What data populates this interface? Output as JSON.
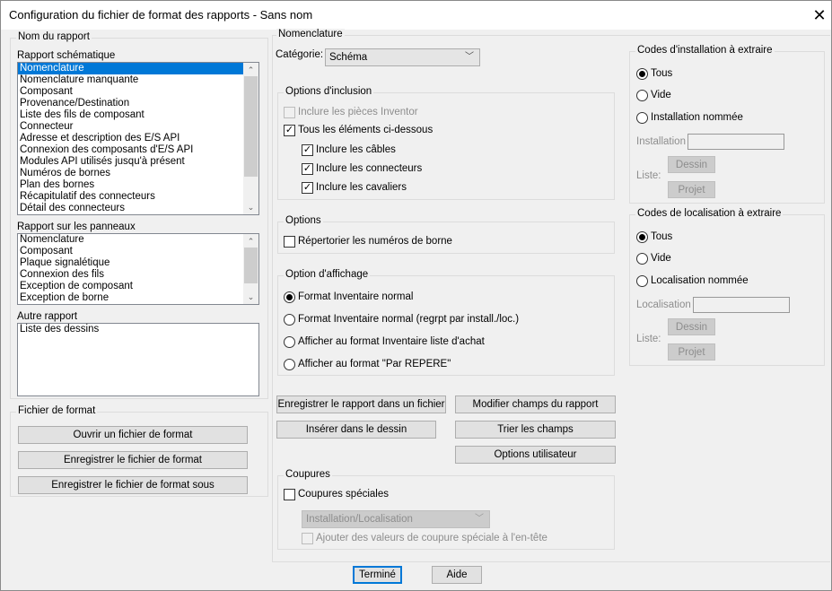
{
  "window": {
    "title": "Configuration du fichier de format des rapports - Sans nom",
    "close": "✕"
  },
  "left": {
    "group_title": "Nom du rapport",
    "schematic_label": "Rapport schématique",
    "schematic_items": [
      "Nomenclature",
      "Nomenclature manquante",
      "Composant",
      "Provenance/Destination",
      "Liste des fils de composant",
      "Connecteur",
      "Adresse et description des E/S API",
      "Connexion des composants d'E/S API",
      "Modules API utilisés jusqu'à présent",
      "Numéros de bornes",
      "Plan des bornes",
      "Récapitulatif des connecteurs",
      "Détail des connecteurs"
    ],
    "panel_label": "Rapport sur les panneaux",
    "panel_items": [
      "Nomenclature",
      "Composant",
      "Plaque signalétique",
      "Connexion des fils",
      "Exception de composant",
      "Exception de borne"
    ],
    "other_label": "Autre rapport",
    "other_items": [
      "Liste des dessins"
    ]
  },
  "format_file": {
    "title": "Fichier de format",
    "open": "Ouvrir un fichier de format",
    "save": "Enregistrer le fichier de format",
    "save_as": "Enregistrer le fichier de format sous"
  },
  "middle": {
    "group_title": "Nomenclature",
    "category_label": "Catégorie:",
    "category_value": "Schéma",
    "inclusion": {
      "title": "Options d'inclusion",
      "inventor": "Inclure les pièces Inventor",
      "all": "Tous les éléments ci-dessous",
      "cables": "Inclure les câbles",
      "connectors": "Inclure les connecteurs",
      "jumpers": "Inclure les cavaliers"
    },
    "options": {
      "title": "Options",
      "list_terminals": "Répertorier les numéros de borne"
    },
    "display": {
      "title": "Option d'affichage",
      "opts": [
        "Format Inventaire normal",
        "Format Inventaire normal (regrpt par install./loc.)",
        "Afficher au format Inventaire liste d'achat",
        "Afficher au format \"Par REPERE\""
      ]
    },
    "buttons": {
      "save_report": "Enregistrer le rapport dans un fichier",
      "modify_fields": "Modifier champs du rapport",
      "insert": "Insérer dans le dessin",
      "sort": "Trier les champs",
      "user_options": "Options utilisateur"
    },
    "breaks": {
      "title": "Coupures",
      "special": "Coupures spéciales",
      "combo": "Installation/Localisation",
      "add_header": "Ajouter des valeurs de coupure spéciale à l'en-tête"
    }
  },
  "install": {
    "title": "Codes d'installation à extraire",
    "all": "Tous",
    "empty": "Vide",
    "named": "Installation nommée",
    "field_label": "Installation",
    "list_label": "Liste:",
    "drawing": "Dessin",
    "project": "Projet"
  },
  "location": {
    "title": "Codes de localisation à extraire",
    "all": "Tous",
    "empty": "Vide",
    "named": "Localisation nommée",
    "field_label": "Localisation",
    "list_label": "Liste:",
    "drawing": "Dessin",
    "project": "Projet"
  },
  "footer": {
    "done": "Terminé",
    "help": "Aide"
  }
}
